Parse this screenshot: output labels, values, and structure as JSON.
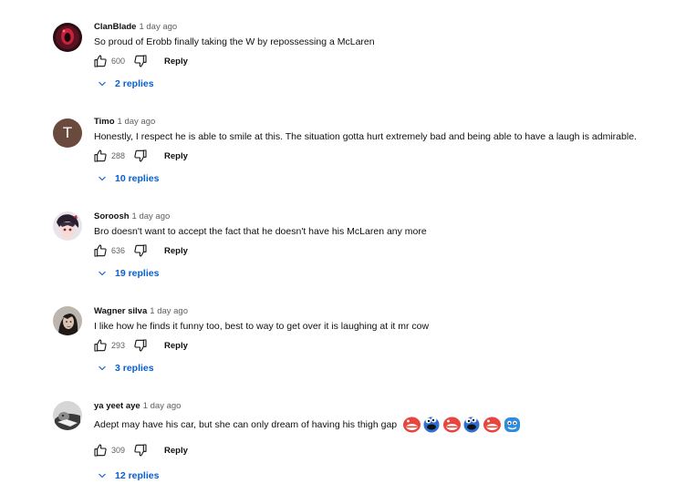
{
  "colors": {
    "link": "#065fd4",
    "meta": "#606060",
    "text": "#0f0f0f"
  },
  "comments": [
    {
      "author": "ClanBlade",
      "time": "1 day ago",
      "text": "So proud of Erobb finally taking the W by repossessing a McLaren",
      "likes": "600",
      "reply_label": "Reply",
      "replies_label": "2 replies",
      "avatar": "image-avatar-dark-red"
    },
    {
      "author": "Timo",
      "time": "1 day ago",
      "text": "Honestly, I respect he is able to smile at this. The situation gotta hurt extremely bad and being able to have a laugh is admirable.",
      "likes": "288",
      "reply_label": "Reply",
      "replies_label": "10 replies",
      "avatar_letter": "T",
      "avatar_color": "#6b4a3e"
    },
    {
      "author": "Soroosh",
      "time": "1 day ago",
      "text": "Bro doesn't want to accept the fact that he doesn't have his McLaren any more",
      "likes": "636",
      "reply_label": "Reply",
      "replies_label": "19 replies",
      "avatar": "image-avatar-anime"
    },
    {
      "author": "Wagner silva",
      "time": "1 day ago",
      "text": "I like how he finds it funny too, best to way to get over it is laughing at it mr cow",
      "likes": "293",
      "reply_label": "Reply",
      "replies_label": "3 replies",
      "avatar": "image-avatar-portrait"
    },
    {
      "author": "ya yeet aye",
      "time": "1 day ago",
      "text": "Adept may have his car, but she can only dream of having his thigh gap",
      "likes": "309",
      "reply_label": "Reply",
      "replies_label": "12 replies",
      "avatar": "image-avatar-monochrome",
      "emojis": [
        "red-face-emoji",
        "blue-monster-emoji",
        "red-face-emoji",
        "blue-monster-emoji",
        "red-face-emoji",
        "blue-face-emoji"
      ]
    }
  ]
}
